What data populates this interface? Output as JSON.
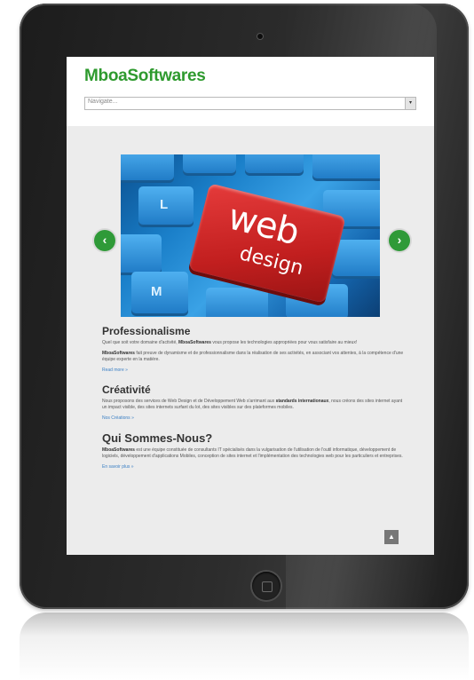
{
  "site": {
    "logo": "MboaSoftwares",
    "nav_placeholder": "Navigate...",
    "nav_arrow": "▾"
  },
  "slider": {
    "headline_top": "web",
    "headline_bottom": "design",
    "keys": [
      "L",
      "M"
    ],
    "prev_label": "‹",
    "next_label": "›"
  },
  "sections": [
    {
      "heading": "Professionalisme",
      "para1_pre": "Quel que soit votre domaine d'activité, ",
      "para1_bold": "MboaSoftwares",
      "para1_post": " vous propose les technologies appropriées pour vous satisfaire au mieux!",
      "para2_bold": "MboaSoftwares",
      "para2_post": " fait preuve de dynamisme et de professionnalisme dans la réalisation de ses activités, en associant vos attentes, à la compétence d'une équipe experte en la matière.",
      "link": "Read more »"
    },
    {
      "heading": "Créativité",
      "para1_pre": "Nous proposons des services de Web Design et de Développement Web s'arrimant aux ",
      "para1_bold": "standards internationaux",
      "para1_post": ", nous créons des sites internet ayant un impact visible, des sites internets surfant du lot, des sites visibles sur des plateformes mobiles.",
      "link": "Nos Créations »"
    },
    {
      "heading": "Qui Sommes-Nous?",
      "para1_bold": "MboaSoftwares",
      "para1_post": " est une équipe constituée de consultants IT spécialisés dans la vulgarisation de l'utilisation de l'outil informatique, développement de logiciels, développement d'applications Mobiles, conception de sites internet et l'implémentation des technologies web pour les particuliers et entreprises.",
      "link": "En savoir plus »"
    }
  ],
  "scroll_top_label": "▲",
  "colors": {
    "brand_green": "#2e9a2e",
    "arrow_green": "#2f9a38",
    "link_blue": "#3a7fc4",
    "web_key_red": "#c21f1f"
  }
}
